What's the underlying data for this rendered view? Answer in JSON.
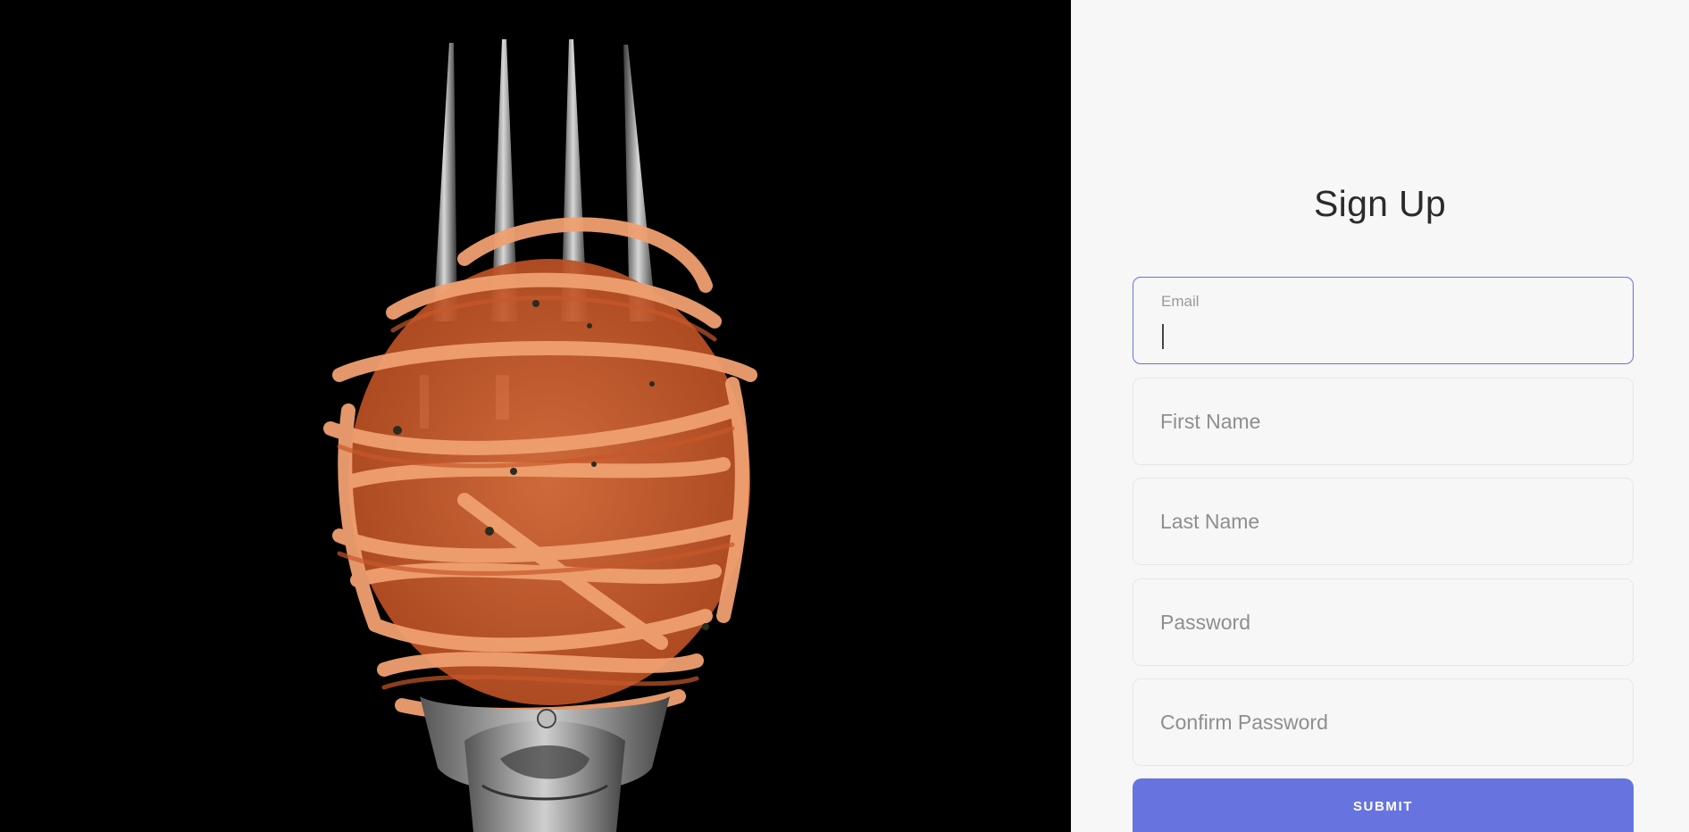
{
  "form": {
    "title": "Sign Up",
    "email": {
      "label": "Email",
      "value": ""
    },
    "first_name": {
      "placeholder": "First Name",
      "value": ""
    },
    "last_name": {
      "placeholder": "Last Name",
      "value": ""
    },
    "password": {
      "placeholder": "Password",
      "value": ""
    },
    "confirm_password": {
      "placeholder": "Confirm Password",
      "value": ""
    },
    "submit_label": "SUBMIT"
  },
  "hero": {
    "subject": "spaghetti twirled on a fork"
  },
  "colors": {
    "accent": "#6774e0",
    "focus_border": "#6373e0",
    "panel_bg": "#f7f7f7",
    "hero_bg": "#000000"
  }
}
